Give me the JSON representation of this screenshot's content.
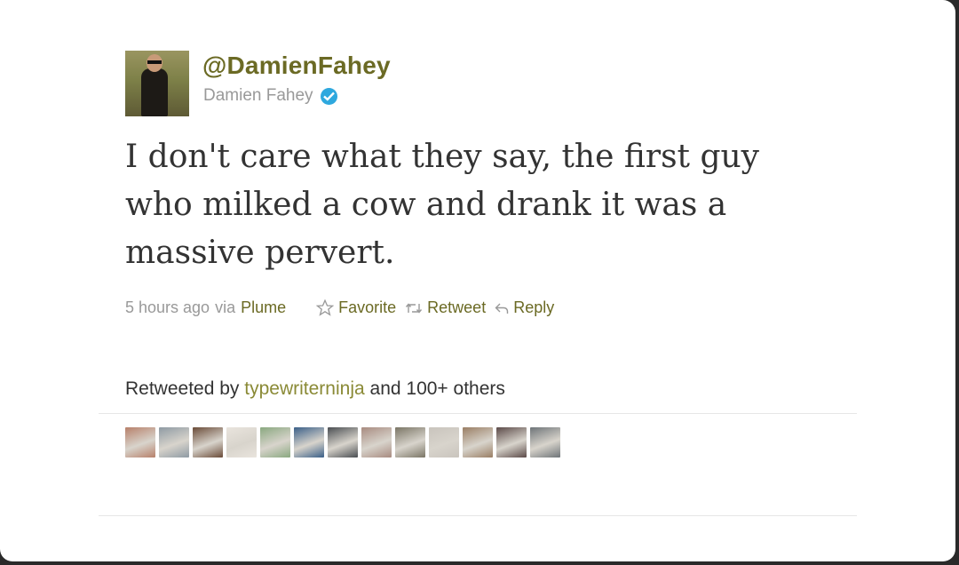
{
  "user": {
    "handle": "@DamienFahey",
    "name": "Damien Fahey"
  },
  "tweet": {
    "text": "I don't care what they say, the first guy who milked a cow and drank it was a massive pervert."
  },
  "meta": {
    "time": "5 hours ago",
    "via_label": "via",
    "source": "Plume",
    "favorite_label": "Favorite",
    "retweet_label": "Retweet",
    "reply_label": "Reply"
  },
  "retweets": {
    "prefix": "Retweeted by",
    "user": "typewriterninja",
    "suffix": "and 100+ others"
  },
  "colors": {
    "link": "#6b6a24",
    "muted": "#999999",
    "verified": "#2ea8de"
  },
  "retweeter_avatars": [
    "#b7806a",
    "#8e9aa3",
    "#6a4b38",
    "#e9e4dd",
    "#8aa880",
    "#3a5f88",
    "#4a4e52",
    "#a88b80",
    "#7a7565",
    "#c9c4bd",
    "#9a7e64",
    "#5b4a48",
    "#6e7478"
  ]
}
